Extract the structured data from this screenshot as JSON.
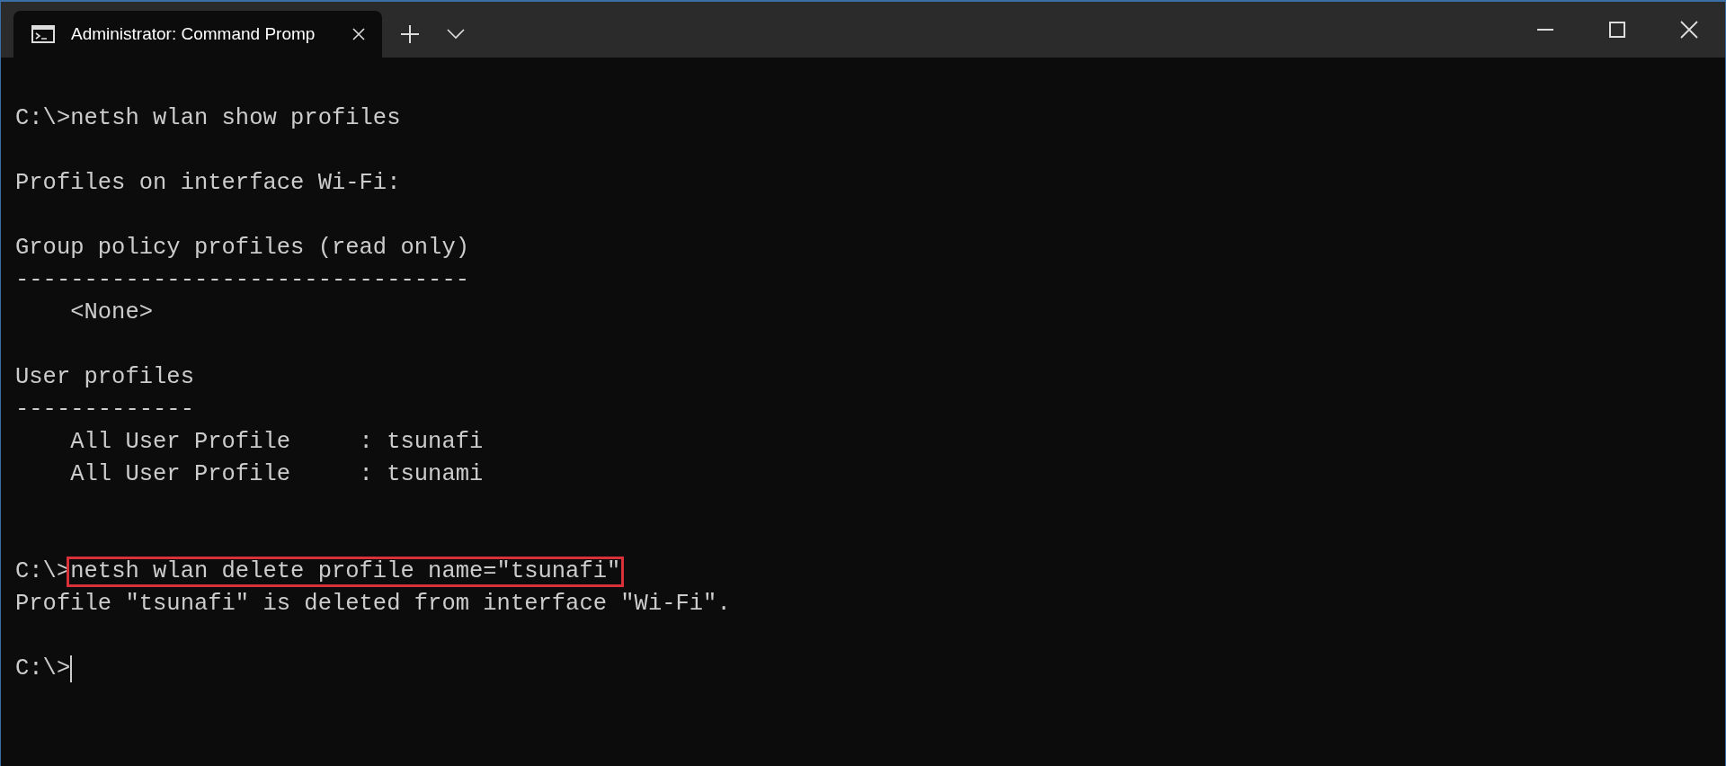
{
  "window": {
    "tab": {
      "title": "Administrator: Command Promp",
      "selected": true
    }
  },
  "lines": [
    {
      "kind": "blank"
    },
    {
      "kind": "command",
      "prompt": "C:\\>",
      "command": "netsh wlan show profiles",
      "highlighted": false
    },
    {
      "kind": "blank"
    },
    {
      "kind": "output",
      "text": "Profiles on interface Wi-Fi:"
    },
    {
      "kind": "blank"
    },
    {
      "kind": "output",
      "text": "Group policy profiles (read only)"
    },
    {
      "kind": "output",
      "text": "---------------------------------"
    },
    {
      "kind": "output",
      "text": "    <None>"
    },
    {
      "kind": "blank"
    },
    {
      "kind": "output",
      "text": "User profiles"
    },
    {
      "kind": "output",
      "text": "-------------"
    },
    {
      "kind": "output",
      "text": "    All User Profile     : tsunafi"
    },
    {
      "kind": "output",
      "text": "    All User Profile     : tsunami"
    },
    {
      "kind": "blank"
    },
    {
      "kind": "blank"
    },
    {
      "kind": "command",
      "prompt": "C:\\>",
      "command": "netsh wlan delete profile name=\"tsunafi\"",
      "highlighted": true
    },
    {
      "kind": "output",
      "text": "Profile \"tsunafi\" is deleted from interface \"Wi-Fi\"."
    },
    {
      "kind": "blank"
    },
    {
      "kind": "input",
      "prompt": "C:\\>",
      "cursor": true
    }
  ]
}
